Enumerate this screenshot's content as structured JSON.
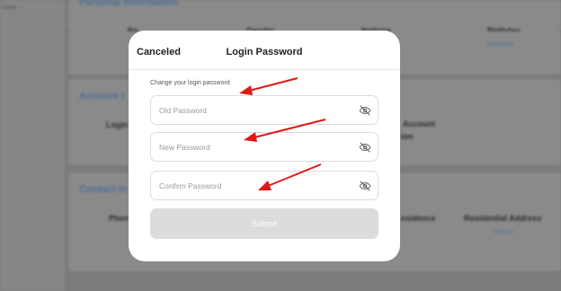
{
  "background": {
    "sidebar_items": [
      "rovide",
      "",
      "",
      "",
      ""
    ],
    "section_personal": "Personal Information",
    "personal_columns": [
      "Na",
      "Gender",
      "Nationa",
      "Birthday"
    ],
    "personal_sub": "Incomplete",
    "section_account": "Account I",
    "account_label_login": "Login",
    "account_label_account": "Account",
    "account_sub": "ion",
    "section_contact": "Contact In",
    "contact_label_phone": "Phon",
    "contact_label_residence": "esidence",
    "contact_label_residential": "Residential Address",
    "contact_sub": "Add one"
  },
  "modal": {
    "cancel_label": "Canceled",
    "title": "Login Password",
    "hint": "Change your login password",
    "fields": [
      {
        "placeholder": "Old Password",
        "icon": "eye-off-icon"
      },
      {
        "placeholder": "New Password",
        "icon": "eye-off-icon"
      },
      {
        "placeholder": "Confirm Password",
        "icon": "eye-off-icon"
      }
    ],
    "submit_label": "Submit"
  },
  "colors": {
    "annotation_arrow": "#e01818",
    "overlay": "#7b7b7b",
    "submit_disabled": "#dcdcdc"
  }
}
